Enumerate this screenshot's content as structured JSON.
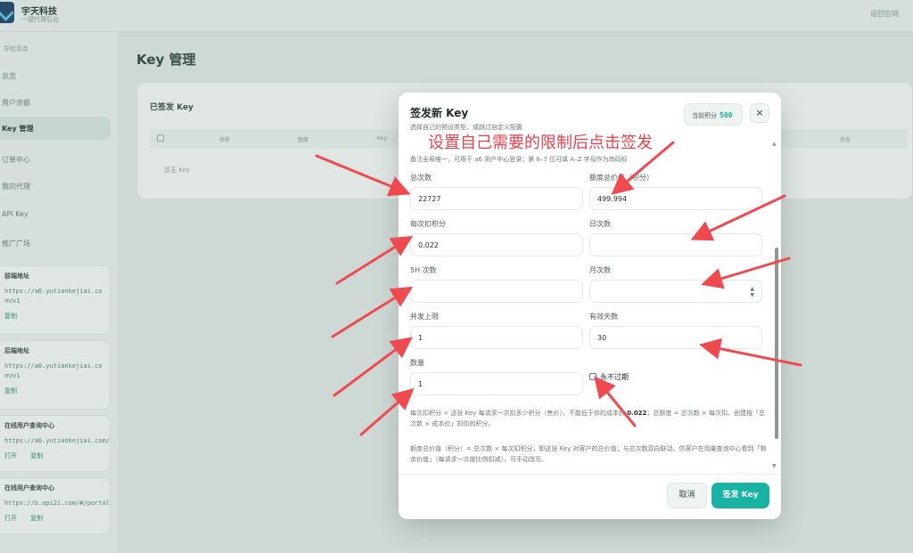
{
  "app": {
    "brand": "宇天科技",
    "brand_sub": "一键代理后台",
    "top_right": "返回官网"
  },
  "sidebar": {
    "caption": "导航菜单",
    "items": [
      {
        "label": "总览"
      },
      {
        "label": "用户余额"
      },
      {
        "label": "Key 管理"
      },
      {
        "label": "订单中心"
      },
      {
        "label": "我的代理"
      },
      {
        "label": "API Key"
      },
      {
        "label": "推广广场"
      }
    ],
    "cards": [
      {
        "title": "前端地址",
        "url": "https://a6.yutiankejiai.co",
        "extra": "m/v1",
        "buttons": [
          "复制"
        ]
      },
      {
        "title": "后端地址",
        "url": "https://a6.yutiankejiai.co",
        "extra": "m/v1",
        "buttons": [
          "复制"
        ]
      },
      {
        "title": "在线用户查询中心",
        "url": "https://a6.yutiankejiai.com/",
        "extra": "",
        "buttons": [
          "打开",
          "复制"
        ]
      },
      {
        "title": "在线用户查询中心",
        "url": "https://b.api2i.com/#/portal",
        "extra": "",
        "buttons": [
          "打开",
          "复制"
        ]
      }
    ]
  },
  "main": {
    "title": "Key 管理",
    "panel_title": "已签发 Key",
    "columns": [
      "名称",
      "额度",
      "Key",
      "状态"
    ],
    "empty_text": "暂无 Key"
  },
  "modal": {
    "title": "签发新 Key",
    "subtitle": "选择自己的预设类型，或跳过自定义配置",
    "points_label": "当前积分",
    "points_value": "500",
    "close": "×",
    "annotation": "设置自己需要的限制后点击签发",
    "note": "备注全局唯一，可用于 a6 用户中心登录；第 6–7 位可填 A–Z 字母作为商码标",
    "fields": {
      "total_count": {
        "label": "总次数",
        "value": "22727"
      },
      "quota_total": {
        "label": "额度总价值（积分）",
        "value": "499.994"
      },
      "per_cost": {
        "label": "每次扣积分",
        "value": "0.022"
      },
      "daily_count": {
        "label": "日次数",
        "value": ""
      },
      "five_h_count": {
        "label": "5H 次数",
        "value": ""
      },
      "monthly_count": {
        "label": "月次数",
        "value": ""
      },
      "concurrency": {
        "label": "并发上限",
        "value": "1"
      },
      "valid_days": {
        "label": "有效天数",
        "value": "30"
      },
      "quantity": {
        "label": "数量",
        "value": "1"
      }
    },
    "never_expire": "永不过期",
    "help1_a": "每次扣积分 = 这张 Key 每请求一次扣多少积分（售价），不能低于你的成本价 ",
    "help1_b": "0.022",
    "help1_c": "；总额度 = 总次数 × 每次扣。创建按「总次数 × 成本价」扣你的积分。",
    "help2": "额度总价值（积分）= 总次数 × 每次扣积分，即这张 Key 对客户的总价值；与总次数双向联动。供客户在用量查询中心看到「剩余价值」（每请求一次按比例扣减），可手动改写。",
    "cancel": "取消",
    "submit": "签发 Key"
  },
  "colors": {
    "accent": "#18b3a4",
    "annotation": "#e8424f"
  }
}
